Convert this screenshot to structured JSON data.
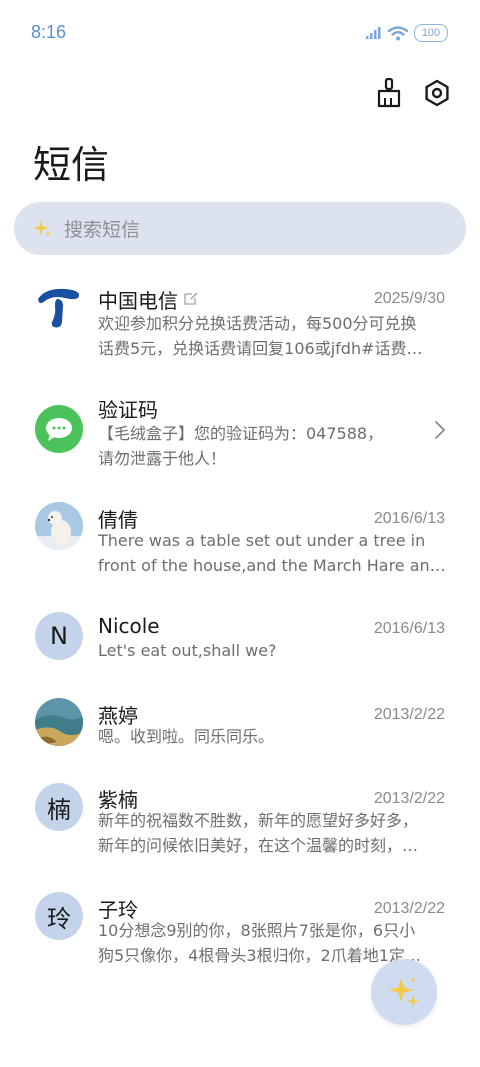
{
  "status_bar": {
    "time": "8:16",
    "battery": "100"
  },
  "header": {
    "title": "短信"
  },
  "toolbar": {
    "clean_icon": "broom-icon",
    "settings_icon": "gear-icon"
  },
  "search": {
    "placeholder": "搜索短信",
    "icon": "sparkle-icon"
  },
  "messages": [
    {
      "sender": "中国电信",
      "date": "2025/9/30",
      "lines": [
        "欢迎参加积分兑换话费活动，每500分可兑换",
        "话费5元，兑换话费请回复106或jfdh#话费…"
      ],
      "avatar": "china-telecom-logo",
      "has_edit_icon": true
    },
    {
      "sender": "验证码",
      "date": "",
      "lines": [
        "【毛绒盒子】您的验证码为：047588，",
        "请勿泄露于他人！"
      ],
      "avatar": "message-bubble-icon",
      "has_chevron": true
    },
    {
      "sender": "倩倩",
      "date": "2016/6/13",
      "lines": [
        "There was a table set out under a tree in",
        "front of the house,and the March Hare an…"
      ],
      "avatar": "polar-bear-photo"
    },
    {
      "sender": "Nicole",
      "date": "2016/6/13",
      "lines": [
        "Let's eat out,shall we?"
      ],
      "avatar_text": "N"
    },
    {
      "sender": "燕婷",
      "date": "2013/2/22",
      "lines": [
        "嗯。收到啦。同乐同乐。"
      ],
      "avatar": "landscape-photo"
    },
    {
      "sender": "紫楠",
      "date": "2013/2/22",
      "lines": [
        "新年的祝福数不胜数，新年的愿望好多好多，",
        "新年的问候依旧美好，在这个温馨的时刻，…"
      ],
      "avatar_text": "楠"
    },
    {
      "sender": "子玲",
      "date": "2013/2/22",
      "lines": [
        "10分想念9别的你，8张照片7张是你，6只小",
        "狗5只像你，4根骨头3根归你，2爪着地1定…"
      ],
      "avatar_text": "玲"
    }
  ],
  "fab": {
    "icon": "sparkle-icon"
  },
  "colors": {
    "accent": "#3a6fd8",
    "search_bg": "#dce3ef",
    "avatar_bg": "#c3d4ea",
    "fab_bg": "#cfdcf0",
    "green": "#4cc35a"
  }
}
